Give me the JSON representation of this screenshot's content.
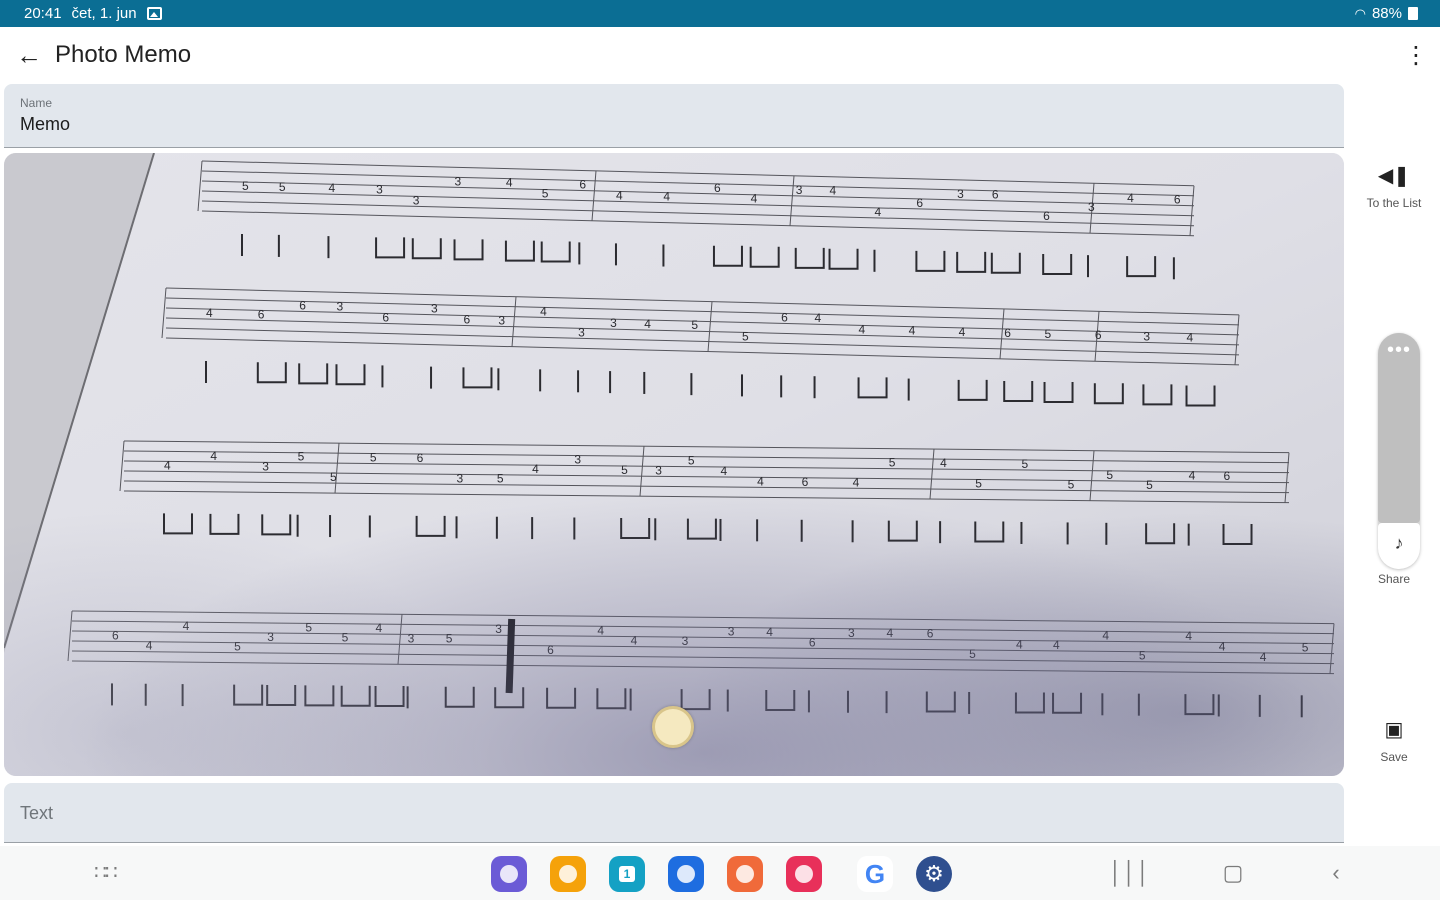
{
  "status_bar": {
    "time": "20:41",
    "date": "čet, 1. jun",
    "battery": "88%"
  },
  "app_bar": {
    "title": "Photo Memo"
  },
  "name_field": {
    "label": "Name",
    "value": "Memo"
  },
  "text_field": {
    "placeholder": "Text"
  },
  "side_rail": {
    "to_list_label": "To the List",
    "share_label": "Share",
    "save_label": "Save"
  },
  "colors": {
    "status_bar": "#0b6e94",
    "field_bg": "#e2e7ed",
    "handle": "#f5e9c0"
  },
  "dock_apps": [
    {
      "icon": "internet-icon",
      "color": "#6b5bd6"
    },
    {
      "icon": "my-files-icon",
      "color": "#f5a20a"
    },
    {
      "icon": "calendar-icon",
      "color": "#14a1c4"
    },
    {
      "icon": "messages-icon",
      "color": "#1e6de0"
    },
    {
      "icon": "contacts-icon",
      "color": "#f06a3a"
    },
    {
      "icon": "screen-recorder-icon",
      "color": "#e8305a"
    },
    {
      "icon": "google-icon",
      "color": "#ffffff"
    },
    {
      "icon": "settings-icon",
      "color": "#2f4f8f"
    }
  ],
  "calendar_day": "1",
  "google_glyph": "G"
}
